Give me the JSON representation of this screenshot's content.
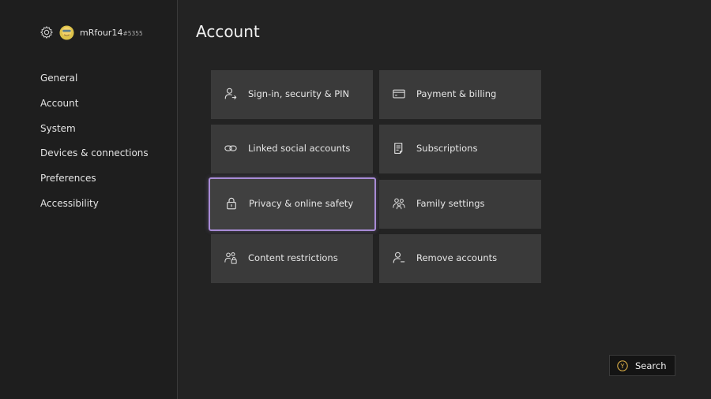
{
  "user": {
    "gamertag": "mRfour14",
    "suffix": "#5355"
  },
  "sidebar": {
    "items": [
      {
        "label": "General"
      },
      {
        "label": "Account"
      },
      {
        "label": "System"
      },
      {
        "label": "Devices & connections"
      },
      {
        "label": "Preferences"
      },
      {
        "label": "Accessibility"
      }
    ]
  },
  "page": {
    "title": "Account"
  },
  "tiles": [
    {
      "label": "Sign-in, security & PIN",
      "icon": "person-arrow-icon"
    },
    {
      "label": "Payment & billing",
      "icon": "credit-card-icon"
    },
    {
      "label": "Linked social accounts",
      "icon": "link-icon"
    },
    {
      "label": "Subscriptions",
      "icon": "document-list-icon"
    },
    {
      "label": "Privacy & online safety",
      "icon": "lock-icon",
      "selected": true
    },
    {
      "label": "Family settings",
      "icon": "family-icon"
    },
    {
      "label": "Content restrictions",
      "icon": "people-lock-icon"
    },
    {
      "label": "Remove accounts",
      "icon": "person-remove-icon"
    }
  ],
  "footer": {
    "button_glyph": "Y",
    "search_label": "Search"
  },
  "colors": {
    "background": "#232323",
    "sidebar": "#1e1e1e",
    "tile": "#3a3a3a",
    "focus_outline": "#a88bd6",
    "y_button": "#e8b84a"
  }
}
